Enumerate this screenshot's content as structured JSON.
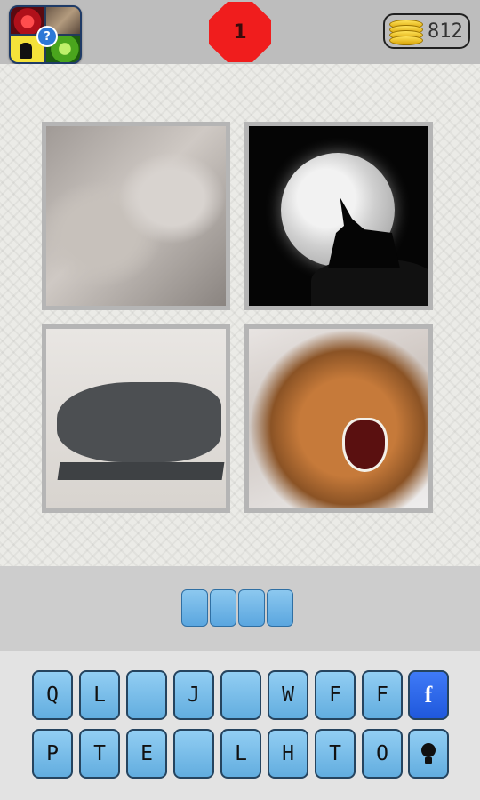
{
  "header": {
    "level": "1",
    "coins": "812"
  },
  "images": [
    {
      "name": "stone-wolves"
    },
    {
      "name": "wolf-howling-moon"
    },
    {
      "name": "capitoline-wolf-statue"
    },
    {
      "name": "snarling-wolf"
    }
  ],
  "answer": {
    "slots": [
      "",
      "",
      "",
      ""
    ]
  },
  "keyboard": {
    "row1": [
      "Q",
      "L",
      "",
      "J",
      "",
      "W",
      "F",
      "F"
    ],
    "row2": [
      "P",
      "T",
      "E",
      "",
      "L",
      "H",
      "T",
      "O"
    ],
    "facebook_label": "f",
    "hint_icon": "lightbulb-icon"
  },
  "colors": {
    "key_blue": "#62addf",
    "facebook_blue": "#1f58dc",
    "level_red": "#f01d1d",
    "coin_gold": "#ffd23a"
  }
}
